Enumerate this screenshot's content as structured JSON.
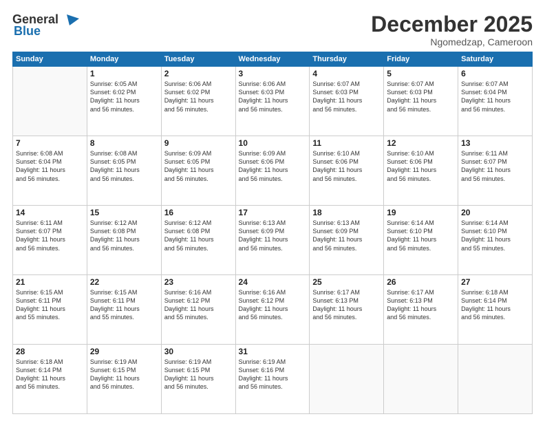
{
  "header": {
    "logo_line1": "General",
    "logo_line2": "Blue",
    "month_title": "December 2025",
    "subtitle": "Ngomedzap, Cameroon"
  },
  "weekdays": [
    "Sunday",
    "Monday",
    "Tuesday",
    "Wednesday",
    "Thursday",
    "Friday",
    "Saturday"
  ],
  "weeks": [
    [
      {
        "day": "",
        "sunrise": "",
        "sunset": "",
        "daylight": ""
      },
      {
        "day": "1",
        "sunrise": "Sunrise: 6:05 AM",
        "sunset": "Sunset: 6:02 PM",
        "daylight": "Daylight: 11 hours and 56 minutes."
      },
      {
        "day": "2",
        "sunrise": "Sunrise: 6:06 AM",
        "sunset": "Sunset: 6:02 PM",
        "daylight": "Daylight: 11 hours and 56 minutes."
      },
      {
        "day": "3",
        "sunrise": "Sunrise: 6:06 AM",
        "sunset": "Sunset: 6:03 PM",
        "daylight": "Daylight: 11 hours and 56 minutes."
      },
      {
        "day": "4",
        "sunrise": "Sunrise: 6:07 AM",
        "sunset": "Sunset: 6:03 PM",
        "daylight": "Daylight: 11 hours and 56 minutes."
      },
      {
        "day": "5",
        "sunrise": "Sunrise: 6:07 AM",
        "sunset": "Sunset: 6:03 PM",
        "daylight": "Daylight: 11 hours and 56 minutes."
      },
      {
        "day": "6",
        "sunrise": "Sunrise: 6:07 AM",
        "sunset": "Sunset: 6:04 PM",
        "daylight": "Daylight: 11 hours and 56 minutes."
      }
    ],
    [
      {
        "day": "7",
        "sunrise": "Sunrise: 6:08 AM",
        "sunset": "Sunset: 6:04 PM",
        "daylight": "Daylight: 11 hours and 56 minutes."
      },
      {
        "day": "8",
        "sunrise": "Sunrise: 6:08 AM",
        "sunset": "Sunset: 6:05 PM",
        "daylight": "Daylight: 11 hours and 56 minutes."
      },
      {
        "day": "9",
        "sunrise": "Sunrise: 6:09 AM",
        "sunset": "Sunset: 6:05 PM",
        "daylight": "Daylight: 11 hours and 56 minutes."
      },
      {
        "day": "10",
        "sunrise": "Sunrise: 6:09 AM",
        "sunset": "Sunset: 6:06 PM",
        "daylight": "Daylight: 11 hours and 56 minutes."
      },
      {
        "day": "11",
        "sunrise": "Sunrise: 6:10 AM",
        "sunset": "Sunset: 6:06 PM",
        "daylight": "Daylight: 11 hours and 56 minutes."
      },
      {
        "day": "12",
        "sunrise": "Sunrise: 6:10 AM",
        "sunset": "Sunset: 6:06 PM",
        "daylight": "Daylight: 11 hours and 56 minutes."
      },
      {
        "day": "13",
        "sunrise": "Sunrise: 6:11 AM",
        "sunset": "Sunset: 6:07 PM",
        "daylight": "Daylight: 11 hours and 56 minutes."
      }
    ],
    [
      {
        "day": "14",
        "sunrise": "Sunrise: 6:11 AM",
        "sunset": "Sunset: 6:07 PM",
        "daylight": "Daylight: 11 hours and 56 minutes."
      },
      {
        "day": "15",
        "sunrise": "Sunrise: 6:12 AM",
        "sunset": "Sunset: 6:08 PM",
        "daylight": "Daylight: 11 hours and 56 minutes."
      },
      {
        "day": "16",
        "sunrise": "Sunrise: 6:12 AM",
        "sunset": "Sunset: 6:08 PM",
        "daylight": "Daylight: 11 hours and 56 minutes."
      },
      {
        "day": "17",
        "sunrise": "Sunrise: 6:13 AM",
        "sunset": "Sunset: 6:09 PM",
        "daylight": "Daylight: 11 hours and 56 minutes."
      },
      {
        "day": "18",
        "sunrise": "Sunrise: 6:13 AM",
        "sunset": "Sunset: 6:09 PM",
        "daylight": "Daylight: 11 hours and 56 minutes."
      },
      {
        "day": "19",
        "sunrise": "Sunrise: 6:14 AM",
        "sunset": "Sunset: 6:10 PM",
        "daylight": "Daylight: 11 hours and 56 minutes."
      },
      {
        "day": "20",
        "sunrise": "Sunrise: 6:14 AM",
        "sunset": "Sunset: 6:10 PM",
        "daylight": "Daylight: 11 hours and 55 minutes."
      }
    ],
    [
      {
        "day": "21",
        "sunrise": "Sunrise: 6:15 AM",
        "sunset": "Sunset: 6:11 PM",
        "daylight": "Daylight: 11 hours and 55 minutes."
      },
      {
        "day": "22",
        "sunrise": "Sunrise: 6:15 AM",
        "sunset": "Sunset: 6:11 PM",
        "daylight": "Daylight: 11 hours and 55 minutes."
      },
      {
        "day": "23",
        "sunrise": "Sunrise: 6:16 AM",
        "sunset": "Sunset: 6:12 PM",
        "daylight": "Daylight: 11 hours and 55 minutes."
      },
      {
        "day": "24",
        "sunrise": "Sunrise: 6:16 AM",
        "sunset": "Sunset: 6:12 PM",
        "daylight": "Daylight: 11 hours and 56 minutes."
      },
      {
        "day": "25",
        "sunrise": "Sunrise: 6:17 AM",
        "sunset": "Sunset: 6:13 PM",
        "daylight": "Daylight: 11 hours and 56 minutes."
      },
      {
        "day": "26",
        "sunrise": "Sunrise: 6:17 AM",
        "sunset": "Sunset: 6:13 PM",
        "daylight": "Daylight: 11 hours and 56 minutes."
      },
      {
        "day": "27",
        "sunrise": "Sunrise: 6:18 AM",
        "sunset": "Sunset: 6:14 PM",
        "daylight": "Daylight: 11 hours and 56 minutes."
      }
    ],
    [
      {
        "day": "28",
        "sunrise": "Sunrise: 6:18 AM",
        "sunset": "Sunset: 6:14 PM",
        "daylight": "Daylight: 11 hours and 56 minutes."
      },
      {
        "day": "29",
        "sunrise": "Sunrise: 6:19 AM",
        "sunset": "Sunset: 6:15 PM",
        "daylight": "Daylight: 11 hours and 56 minutes."
      },
      {
        "day": "30",
        "sunrise": "Sunrise: 6:19 AM",
        "sunset": "Sunset: 6:15 PM",
        "daylight": "Daylight: 11 hours and 56 minutes."
      },
      {
        "day": "31",
        "sunrise": "Sunrise: 6:19 AM",
        "sunset": "Sunset: 6:16 PM",
        "daylight": "Daylight: 11 hours and 56 minutes."
      },
      {
        "day": "",
        "sunrise": "",
        "sunset": "",
        "daylight": ""
      },
      {
        "day": "",
        "sunrise": "",
        "sunset": "",
        "daylight": ""
      },
      {
        "day": "",
        "sunrise": "",
        "sunset": "",
        "daylight": ""
      }
    ]
  ]
}
